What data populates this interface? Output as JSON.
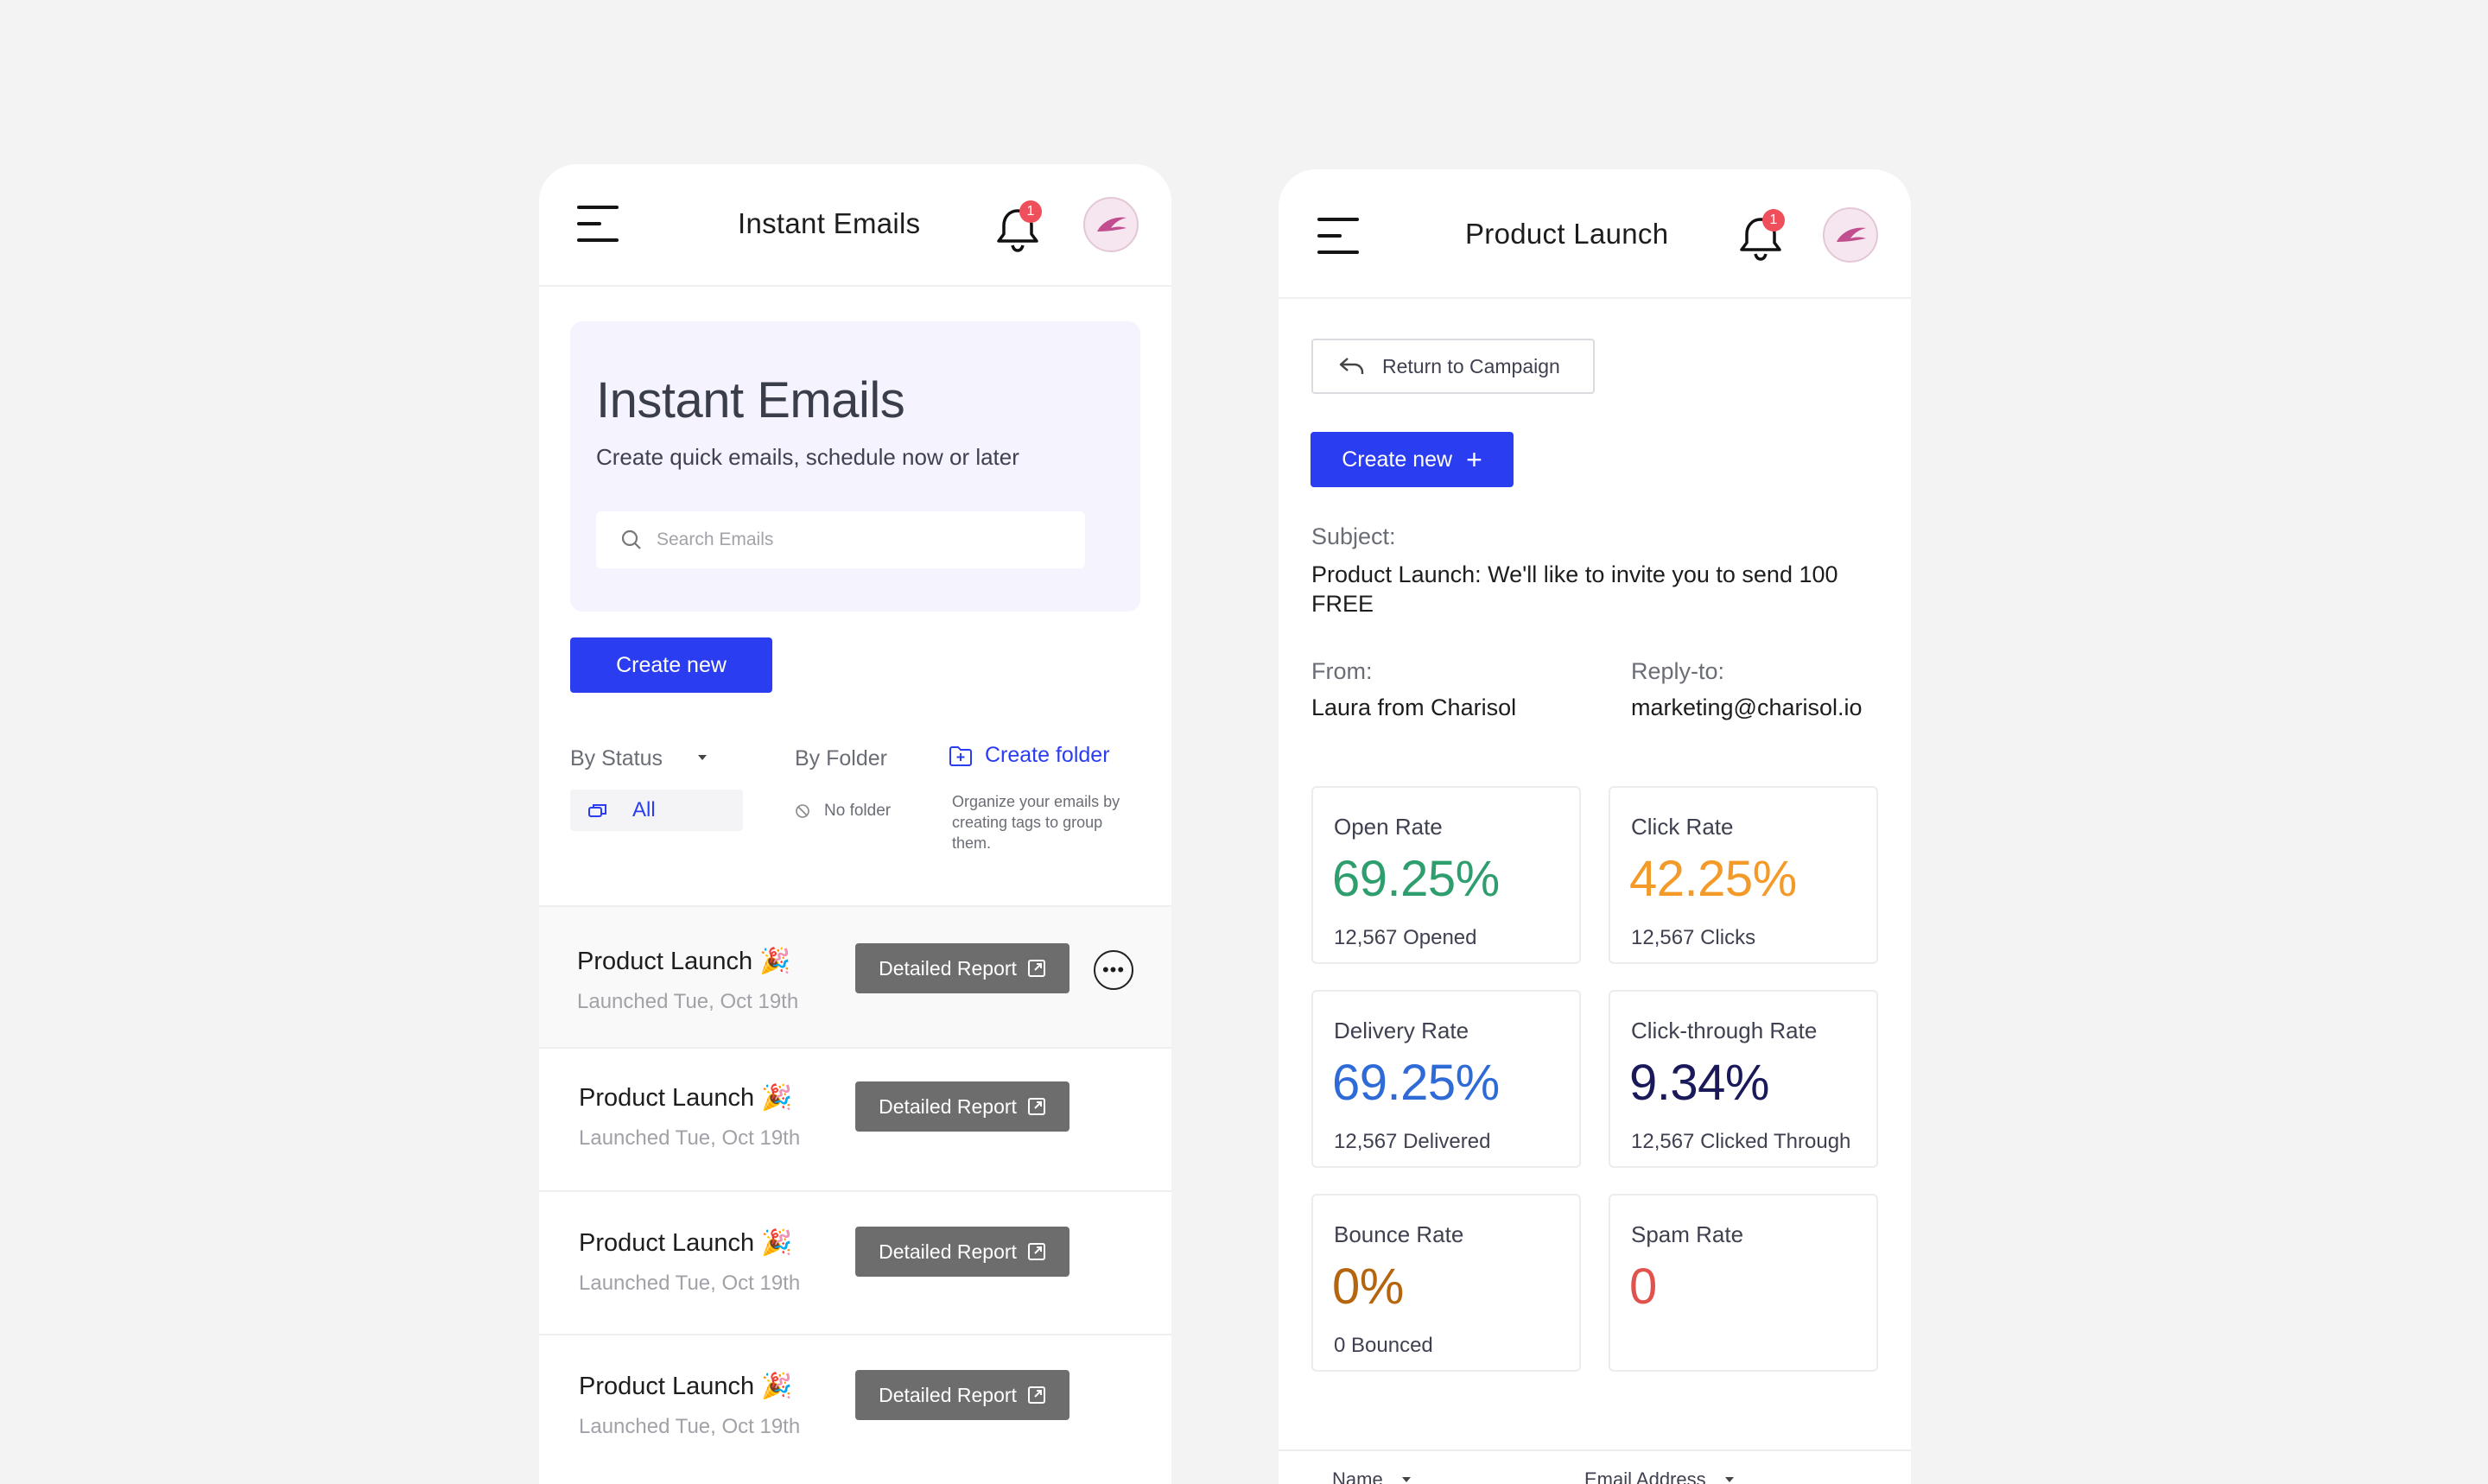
{
  "left_screen": {
    "topbar": {
      "title": "Instant Emails",
      "notification_count": "1"
    },
    "hero": {
      "title": "Instant Emails",
      "subtitle": "Create quick emails, schedule now or later",
      "search_placeholder": "Search Emails"
    },
    "create_new_label": "Create new",
    "filters": {
      "by_status": "By Status",
      "status_selected": "All",
      "by_folder": "By Folder",
      "no_folder": "No folder",
      "create_folder": "Create folder",
      "folder_hint": "Organize your emails by creating tags to group them."
    },
    "emails": [
      {
        "title": "Product Launch 🎉",
        "subtitle": "Launched Tue, Oct 19th",
        "action": "Detailed Report"
      },
      {
        "title": "Product Launch 🎉",
        "subtitle": "Launched Tue, Oct 19th",
        "action": "Detailed Report"
      },
      {
        "title": "Product Launch 🎉",
        "subtitle": "Launched Tue, Oct 19th",
        "action": "Detailed Report"
      },
      {
        "title": "Product Launch 🎉",
        "subtitle": "Launched Tue, Oct 19th",
        "action": "Detailed Report"
      }
    ]
  },
  "right_screen": {
    "topbar": {
      "title": "Product Launch",
      "notification_count": "1"
    },
    "return_label": "Return to Campaign",
    "create_new_label": "Create new",
    "subject_label": "Subject:",
    "subject_value": "Product Launch: We'll like to invite you to send 100 FREE",
    "from_label": "From:",
    "from_value": "Laura from Charisol",
    "reply_label": "Reply-to:",
    "reply_value": "marketing@charisol.io",
    "stats": [
      {
        "label": "Open Rate",
        "value": "69.25%",
        "sub": "12,567 Opened",
        "color": "#2e9e6e"
      },
      {
        "label": "Click Rate",
        "value": "42.25%",
        "sub": "12,567 Clicks",
        "color": "#f39a29"
      },
      {
        "label": "Delivery Rate",
        "value": "69.25%",
        "sub": "12,567 Delivered",
        "color": "#2f6bd6"
      },
      {
        "label": "Click-through Rate",
        "value": "9.34%",
        "sub": "12,567 Clicked Through",
        "color": "#1a1a5a"
      },
      {
        "label": "Bounce Rate",
        "value": "0%",
        "sub": "0 Bounced",
        "color": "#b5650e"
      },
      {
        "label": "Spam Rate",
        "value": "0",
        "sub": "",
        "color": "#e2524c"
      }
    ],
    "table_columns": [
      "Name",
      "Email Address"
    ]
  },
  "colors": {
    "primary": "#2b3df0",
    "badge": "#ef4f5b",
    "hero_bg": "#f5f3fd"
  }
}
